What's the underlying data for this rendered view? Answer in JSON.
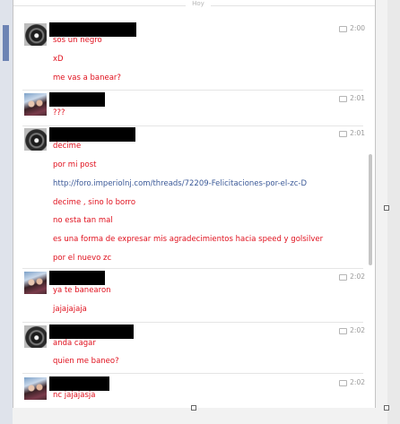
{
  "header": {
    "day_label": "Hoy"
  },
  "messages": [
    {
      "avatar": "dark",
      "time": "2:00",
      "lines": [
        {
          "text": "sos un negro"
        },
        {
          "text": "xD"
        },
        {
          "text": "me vas a banear?"
        }
      ]
    },
    {
      "avatar": "girls",
      "time": "2:01",
      "lines": [
        {
          "text": "???"
        }
      ]
    },
    {
      "avatar": "dark",
      "time": "2:01",
      "lines": [
        {
          "text": "decime"
        },
        {
          "text": "por mi post"
        },
        {
          "text": "http://foro.imperiolnj.com/threads/72209-Felicitaciones-por-el-zc-D",
          "link": true
        },
        {
          "text": "decime , sino lo borro"
        },
        {
          "text": "no esta  tan mal"
        },
        {
          "text": "es una forma de expresar mis agradecimientos hacia speed y golsilver"
        },
        {
          "text": "por el nuevo zc"
        }
      ]
    },
    {
      "avatar": "girls",
      "time": "2:02",
      "lines": [
        {
          "text": "ya te banearon"
        },
        {
          "text": "jajajajaja"
        }
      ]
    },
    {
      "avatar": "dark",
      "time": "2:02",
      "lines": [
        {
          "text": "anda cagar"
        },
        {
          "text": "quien me baneo?"
        }
      ]
    },
    {
      "avatar": "girls",
      "time": "2:02",
      "lines": [
        {
          "text": "nc jajajasja"
        }
      ]
    }
  ],
  "colors": {
    "message_text": "#e0101d",
    "link_text": "#3b5998",
    "redaction": "#000000"
  },
  "icons": {
    "time_marker": "speech-bubble-icon"
  }
}
